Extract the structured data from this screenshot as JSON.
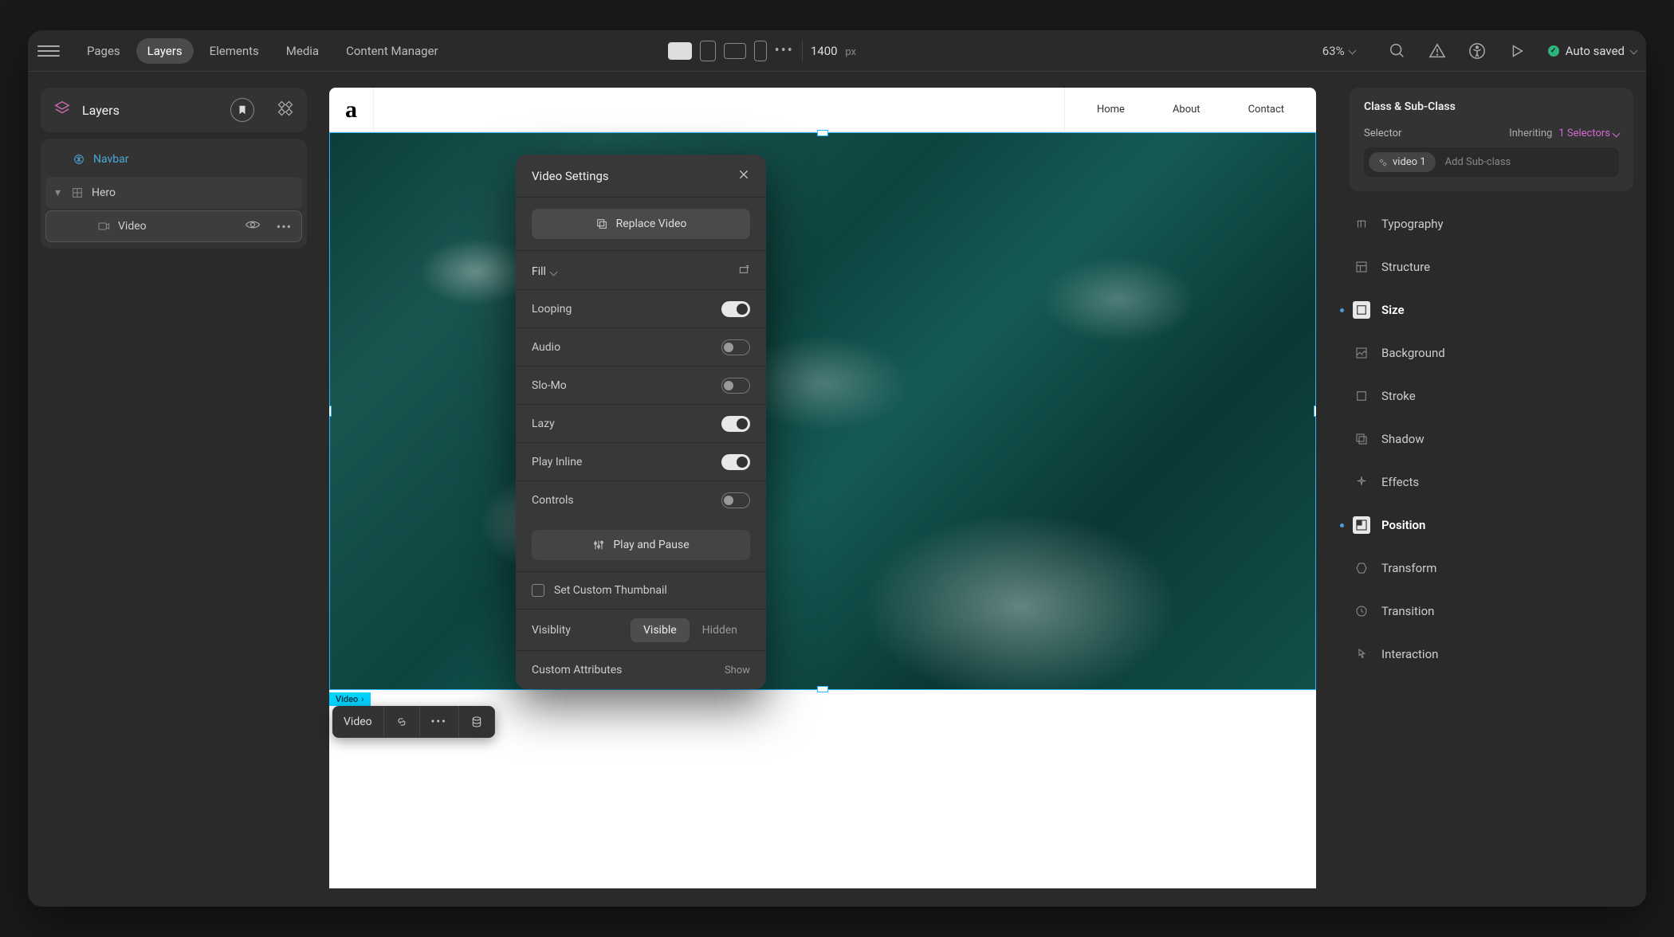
{
  "topbar": {
    "tabs": [
      "Pages",
      "Layers",
      "Elements",
      "Media",
      "Content Manager"
    ],
    "active_tab_index": 1,
    "canvas_width": "1400",
    "canvas_unit": "px",
    "zoom": "63%",
    "saved_label": "Auto saved"
  },
  "left_panel": {
    "title": "Layers",
    "tree": {
      "navbar": "Navbar",
      "hero": "Hero",
      "video": "Video"
    }
  },
  "canvas": {
    "logo": "a",
    "nav_links": [
      "Home",
      "About",
      "Contact"
    ],
    "selection_tag": "Video",
    "floating_toolbar_label": "Video"
  },
  "popover": {
    "title": "Video Settings",
    "replace_label": "Replace Video",
    "fill_label": "Fill",
    "toggles": {
      "looping": {
        "label": "Looping",
        "on": true
      },
      "audio": {
        "label": "Audio",
        "on": false
      },
      "slomo": {
        "label": "Slo-Mo",
        "on": false
      },
      "lazy": {
        "label": "Lazy",
        "on": true
      },
      "play_inline": {
        "label": "Play Inline",
        "on": true
      },
      "controls": {
        "label": "Controls",
        "on": false
      }
    },
    "play_pause_label": "Play and Pause",
    "thumbnail_label": "Set Custom Thumbnail",
    "visibility_label": "Visiblity",
    "visibility_options": [
      "Visible",
      "Hidden"
    ],
    "custom_attrs_label": "Custom Attributes",
    "show_label": "Show"
  },
  "right_panel": {
    "class_title": "Class & Sub-Class",
    "selector_label": "Selector",
    "inheriting_label": "Inheriting",
    "selectors_count": "1 Selectors",
    "chip_label": "video 1",
    "add_sub_placeholder": "Add Sub-class",
    "sections": [
      {
        "key": "typography",
        "label": "Typography",
        "highlight": false
      },
      {
        "key": "structure",
        "label": "Structure",
        "highlight": false
      },
      {
        "key": "size",
        "label": "Size",
        "highlight": true
      },
      {
        "key": "background",
        "label": "Background",
        "highlight": false
      },
      {
        "key": "stroke",
        "label": "Stroke",
        "highlight": false
      },
      {
        "key": "shadow",
        "label": "Shadow",
        "highlight": false
      },
      {
        "key": "effects",
        "label": "Effects",
        "highlight": false
      },
      {
        "key": "position",
        "label": "Position",
        "highlight": true
      },
      {
        "key": "transform",
        "label": "Transform",
        "highlight": false
      },
      {
        "key": "transition",
        "label": "Transition",
        "highlight": false
      },
      {
        "key": "interaction",
        "label": "Interaction",
        "highlight": false
      }
    ]
  }
}
